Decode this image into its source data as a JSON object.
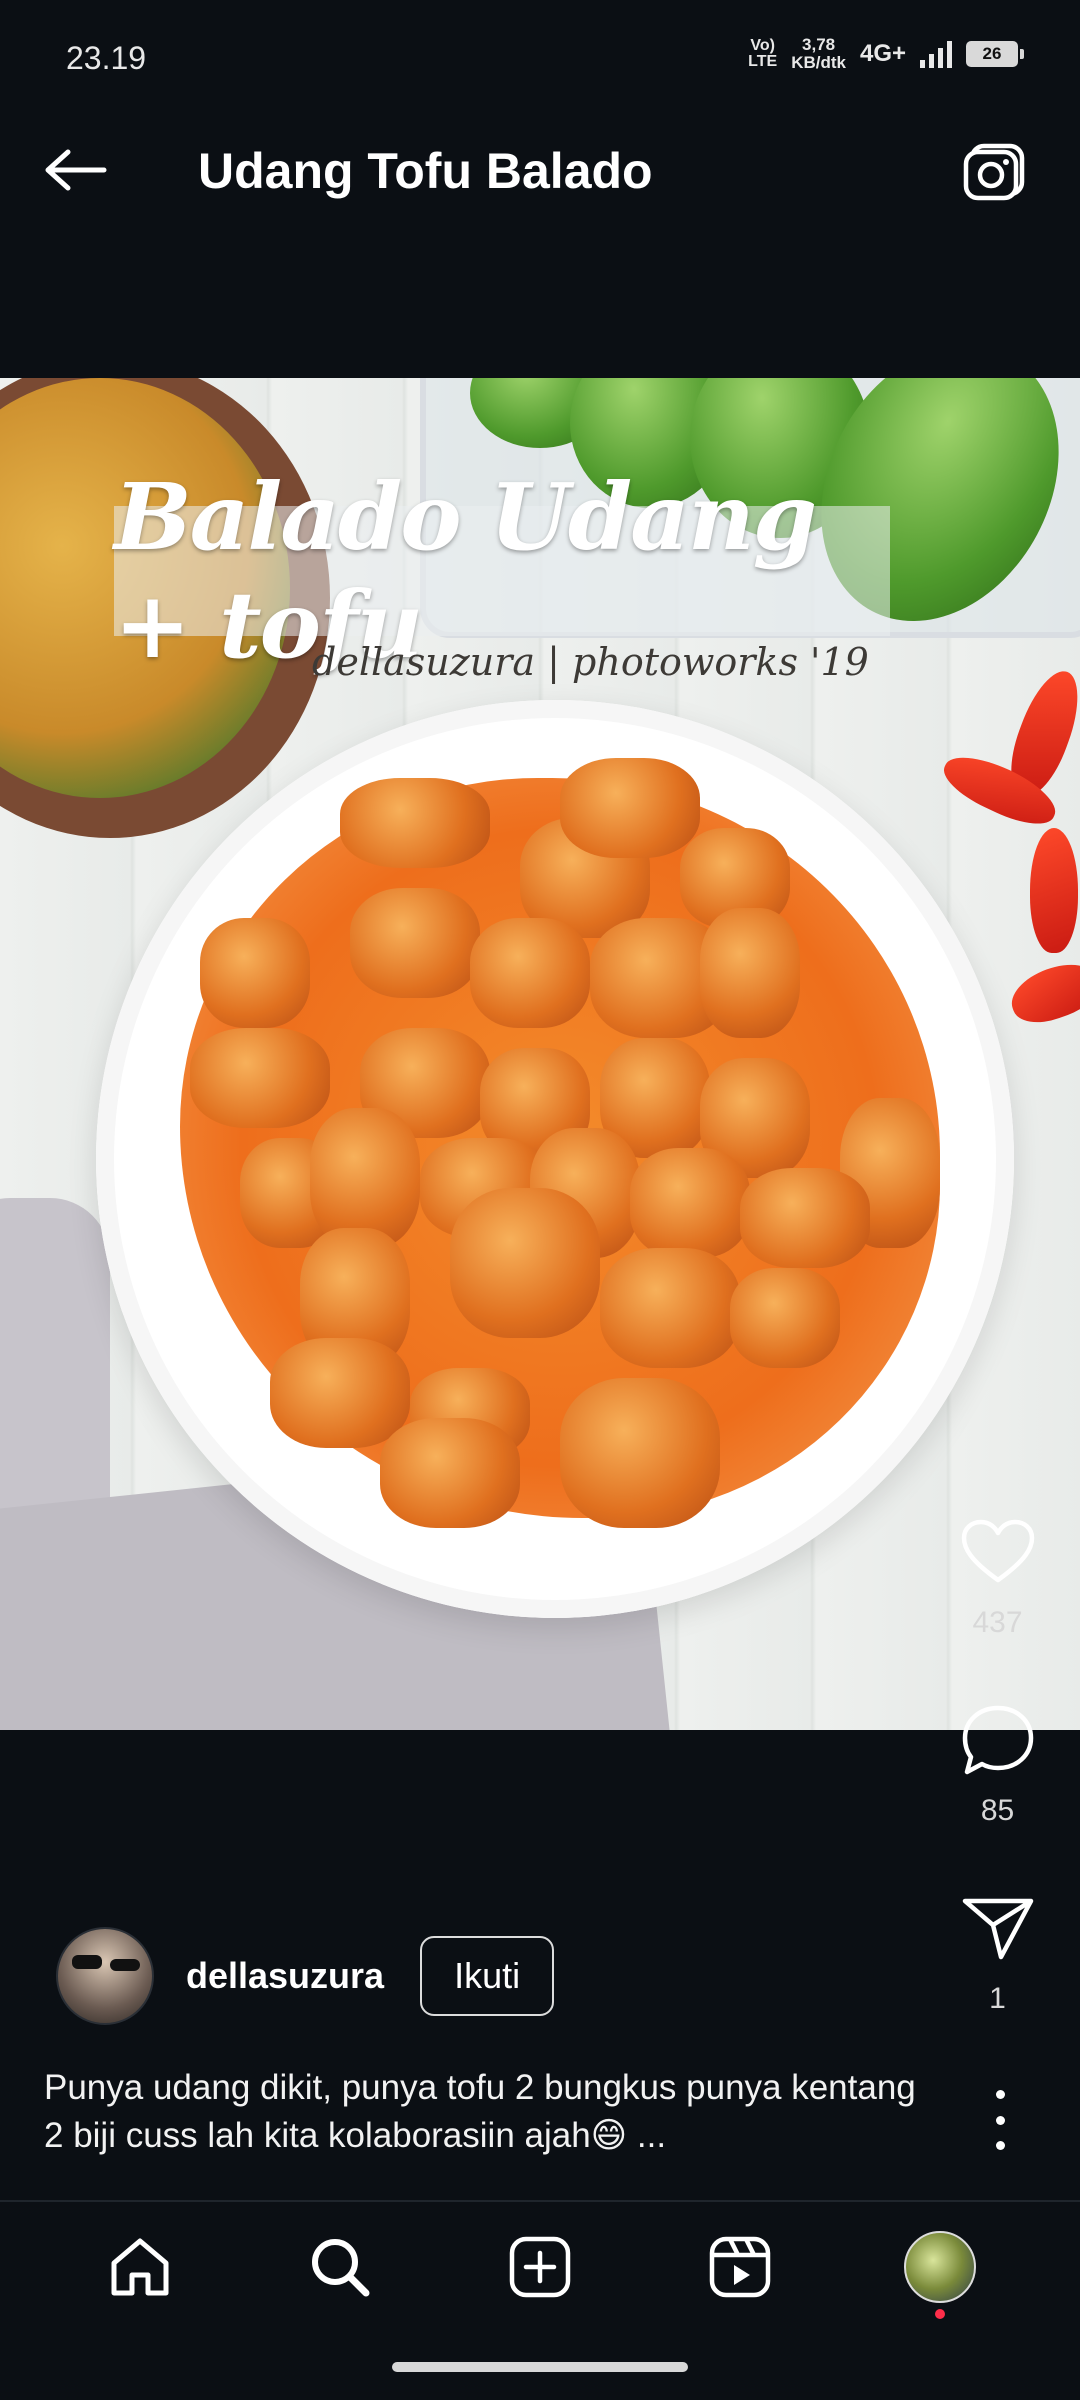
{
  "status_bar": {
    "time": "23.19",
    "lte_top": "Vo)",
    "lte_bottom": "LTE",
    "speed_top": "3,78",
    "speed_bottom": "KB/dtk",
    "network": "4G+",
    "battery": "26"
  },
  "header": {
    "title": "Udang Tofu Balado",
    "back_icon": "arrow-left-icon",
    "camera_icon": "camera-icon"
  },
  "post": {
    "image_overlay_title": "Balado Udang + tofu",
    "image_overlay_credit": "dellasuzura | photoworks '19",
    "likes": "437",
    "comments": "85",
    "shares": "1",
    "author": "dellasuzura",
    "follow_label": "Ikuti",
    "caption": "Punya udang dikit, punya tofu 2 bungkus punya kentang 2 biji cuss lah kita kolaborasiin ajah😄 ..."
  },
  "bottom_nav": {
    "items": [
      "home-icon",
      "search-icon",
      "add-post-icon",
      "reels-icon",
      "profile-avatar"
    ]
  },
  "colors": {
    "background": "#0b0f14",
    "text": "#ffffff",
    "notification_dot": "#ff2e4a"
  }
}
